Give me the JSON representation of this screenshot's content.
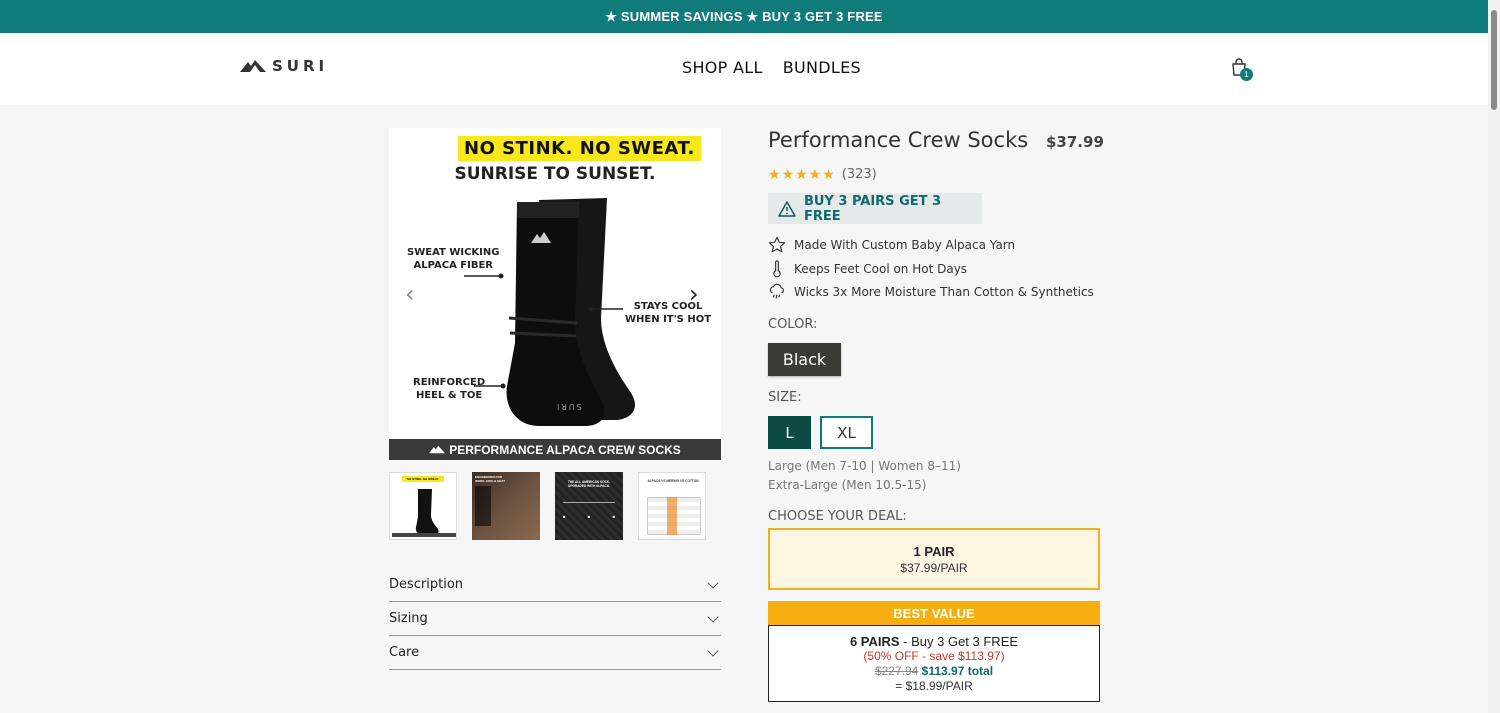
{
  "promo_bar": {
    "text": "★ SUMMER SAVINGS ★ BUY 3 GET 3 FREE"
  },
  "header": {
    "logo_text": "SURI",
    "nav": [
      {
        "label": "SHOP ALL"
      },
      {
        "label": "BUNDLES"
      }
    ],
    "cart_count": "1",
    "brand_color": "#0f7b7b"
  },
  "gallery": {
    "hero": {
      "headline": "NO STINK. NO SWEAT.",
      "subheadline": "SUNRISE TO SUNSET.",
      "callout_left_top": "SWEAT WICKING\nALPACA FIBER",
      "callout_right": "STAYS COOL\nWHEN IT'S HOT",
      "callout_left_bottom": "REINFORCED\nHEEL & TOE",
      "footer_banner": "PERFORMANCE ALPACA CREW SOCKS",
      "sock_text": "SURI"
    },
    "thumbnails": [
      {
        "alt": "No stink no sweat",
        "caption": "NO STINK. NO SWEAT."
      },
      {
        "alt": "Engineered for work, hike & heat",
        "caption": "ENGINEERED FOR WORK, HIKE & HEAT"
      },
      {
        "alt": "The all american sock",
        "caption": "THE ALL AMERICAN SOCK, UPGRADED WITH ALPACA."
      },
      {
        "alt": "Alpaca vs merino vs cotton",
        "caption": "ALPACA VS MERINO VS COTTON"
      }
    ],
    "accordion": [
      {
        "label": "Description"
      },
      {
        "label": "Sizing"
      },
      {
        "label": "Care"
      }
    ]
  },
  "product": {
    "title": "Performance Crew Socks",
    "price": "$37.99",
    "rating": 5,
    "stars": "★★★★★",
    "review_count": "(323)",
    "deal_badge": "BUY 3 PAIRS GET 3 FREE",
    "features": [
      {
        "icon": "star-icon",
        "text": "Made With Custom Baby Alpaca Yarn"
      },
      {
        "icon": "thermometer-icon",
        "text": "Keeps Feet Cool on Hot Days"
      },
      {
        "icon": "rain-cloud-icon",
        "text": "Wicks 3x More Moisture Than Cotton & Synthetics"
      }
    ],
    "color_label": "COLOR:",
    "color_selected": "Black",
    "size_label": "SIZE:",
    "sizes": [
      {
        "label": "L",
        "selected": true
      },
      {
        "label": "XL",
        "selected": false
      }
    ],
    "size_notes": [
      "Large (Men 7-10 | Women 8–11)",
      "Extra-Large (Men 10.5-15)"
    ],
    "deal_label": "CHOOSE YOUR DEAL:",
    "deals": [
      {
        "quantity": "1 PAIR",
        "price_line": "$37.99/PAIR"
      },
      {
        "banner": "BEST VALUE",
        "quantity": "6 PAIRS",
        "offer": " - Buy 3 Get 3 FREE",
        "discount": "(50% OFF - save $113.97)",
        "old_price": "$227.94",
        "new_price": "$113.97 total",
        "per_pair": "= $18.99/PAIR"
      }
    ]
  }
}
